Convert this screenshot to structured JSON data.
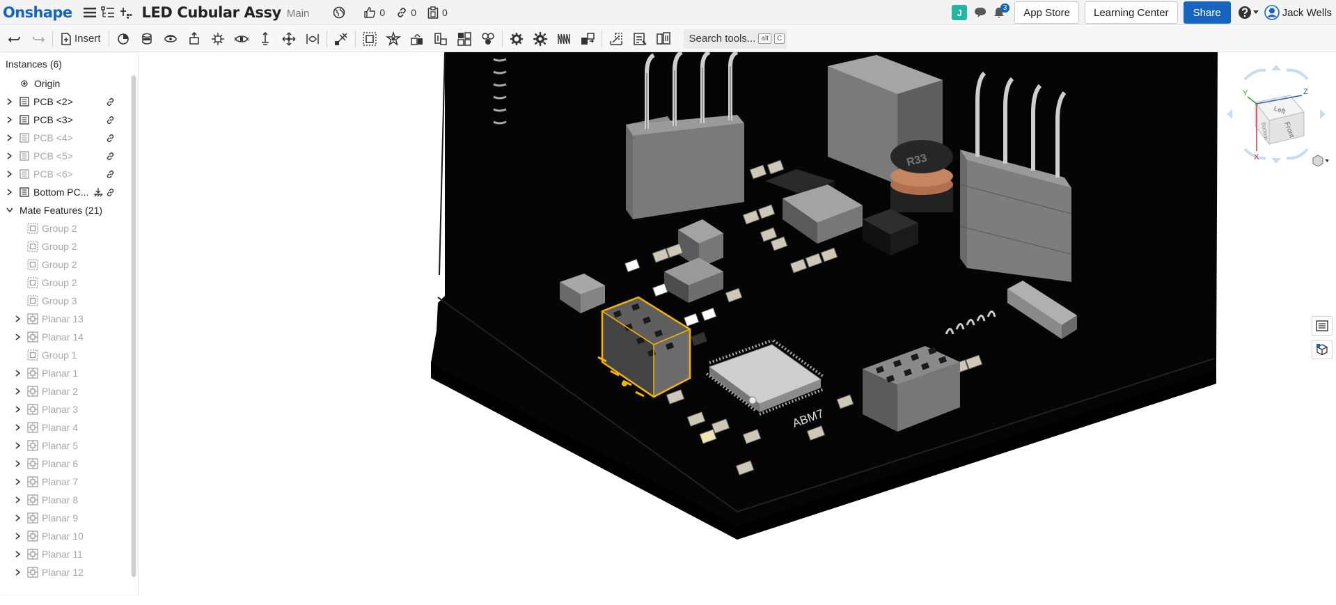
{
  "topbar": {
    "logo": "Onshape",
    "document_title": "LED Cubular Assy",
    "branch": "Main",
    "likes": "0",
    "links": "0",
    "copies": "0",
    "user_initial": "J",
    "notification_count": "3",
    "app_store_label": "App Store",
    "learning_center_label": "Learning Center",
    "share_label": "Share",
    "user_name": "Jack Wells"
  },
  "toolbar": {
    "insert_label": "Insert",
    "search_label": "Search tools...",
    "search_shortcut_1": "alt",
    "search_shortcut_2": "C"
  },
  "panel": {
    "instances_header": "Instances (6)",
    "origin_label": "Origin",
    "instances": [
      {
        "label": "PCB <2>",
        "dim": false
      },
      {
        "label": "PCB <3>",
        "dim": false
      },
      {
        "label": "PCB <4>",
        "dim": true
      },
      {
        "label": "PCB <5>",
        "dim": true
      },
      {
        "label": "PCB <6>",
        "dim": true
      },
      {
        "label": "Bottom PC...",
        "dim": false
      }
    ],
    "mate_features_label": "Mate Features (21)",
    "mates": [
      {
        "label": "Group 2",
        "type": "group",
        "expandable": false
      },
      {
        "label": "Group 2",
        "type": "group",
        "expandable": false
      },
      {
        "label": "Group 2",
        "type": "group",
        "expandable": false
      },
      {
        "label": "Group 2",
        "type": "group",
        "expandable": false
      },
      {
        "label": "Group 3",
        "type": "group",
        "expandable": false
      },
      {
        "label": "Planar 13",
        "type": "planar",
        "expandable": true
      },
      {
        "label": "Planar 14",
        "type": "planar",
        "expandable": true
      },
      {
        "label": "Group 1",
        "type": "group",
        "expandable": false
      },
      {
        "label": "Planar 1",
        "type": "planar",
        "expandable": true
      },
      {
        "label": "Planar 2",
        "type": "planar",
        "expandable": true
      },
      {
        "label": "Planar 3",
        "type": "planar",
        "expandable": true
      },
      {
        "label": "Planar 4",
        "type": "planar",
        "expandable": true
      },
      {
        "label": "Planar 5",
        "type": "planar",
        "expandable": true
      },
      {
        "label": "Planar 6",
        "type": "planar",
        "expandable": true
      },
      {
        "label": "Planar 7",
        "type": "planar",
        "expandable": true
      },
      {
        "label": "Planar 8",
        "type": "planar",
        "expandable": true
      },
      {
        "label": "Planar 9",
        "type": "planar",
        "expandable": true
      },
      {
        "label": "Planar 10",
        "type": "planar",
        "expandable": true
      },
      {
        "label": "Planar 11",
        "type": "planar",
        "expandable": true
      },
      {
        "label": "Planar 12",
        "type": "planar",
        "expandable": true
      }
    ]
  },
  "viewport": {
    "chip_label": "ABM7",
    "inductor_label": "R33",
    "view_cube_faces": {
      "left": "Left",
      "front": "Front",
      "bottom": "Bottom"
    },
    "axis_labels": {
      "x": "X",
      "y": "Y",
      "z": "Z"
    }
  },
  "colors": {
    "brand": "#1565c0",
    "selection": "#f5b400",
    "board": "#050505",
    "user_badge": "#22b8a0"
  }
}
